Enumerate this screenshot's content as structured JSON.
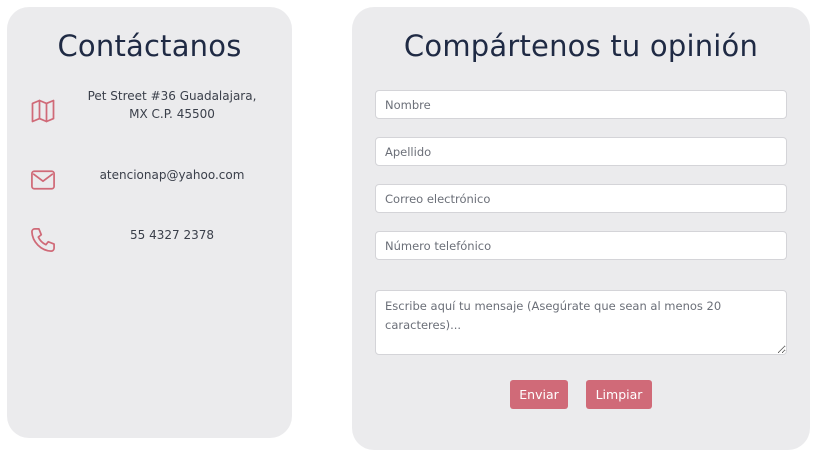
{
  "contact": {
    "title": "Contáctanos",
    "address_line1": "Pet Street #36 Guadalajara,",
    "address_line2": "MX C.P. 45500",
    "email": "atencionap@yahoo.com",
    "phone": "55 4327 2378",
    "icons": [
      "map-icon",
      "envelope-icon",
      "phone-icon"
    ],
    "icon_color": "#d06a78"
  },
  "form": {
    "title": "Compártenos tu opinión",
    "nombre_placeholder": "Nombre",
    "apellido_placeholder": "Apellido",
    "correo_placeholder": "Correo electrónico",
    "telefono_placeholder": "Número telefónico",
    "mensaje_placeholder": "Escribe aquí tu mensaje (Asegúrate que sean al menos 20 caracteres)...",
    "send_label": "Enviar",
    "clear_label": "Limpiar",
    "button_color": "#d06a78"
  }
}
